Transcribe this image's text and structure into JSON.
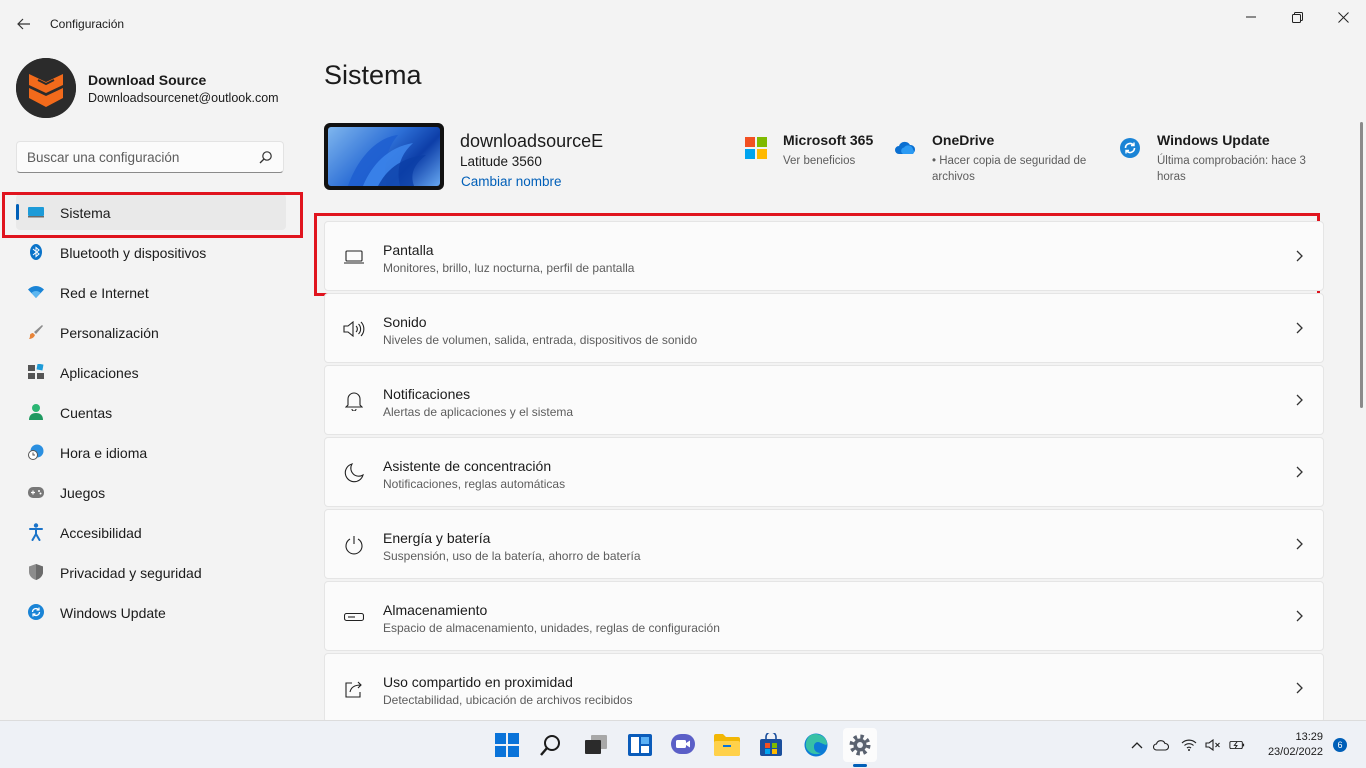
{
  "window": {
    "title": "Configuración"
  },
  "profile": {
    "name": "Download Source",
    "email": "Downloadsourcenet@outlook.com"
  },
  "search": {
    "placeholder": "Buscar una configuración"
  },
  "sidebar": {
    "items": [
      {
        "label": "Sistema",
        "icon": "system-icon",
        "selected": true
      },
      {
        "label": "Bluetooth y dispositivos",
        "icon": "bluetooth-icon"
      },
      {
        "label": "Red e Internet",
        "icon": "wifi-icon"
      },
      {
        "label": "Personalización",
        "icon": "brush-icon"
      },
      {
        "label": "Aplicaciones",
        "icon": "apps-icon"
      },
      {
        "label": "Cuentas",
        "icon": "person-icon"
      },
      {
        "label": "Hora e idioma",
        "icon": "clock-globe-icon"
      },
      {
        "label": "Juegos",
        "icon": "gamepad-icon"
      },
      {
        "label": "Accesibilidad",
        "icon": "accessibility-icon"
      },
      {
        "label": "Privacidad y seguridad",
        "icon": "shield-icon"
      },
      {
        "label": "Windows Update",
        "icon": "update-icon"
      }
    ]
  },
  "main": {
    "title": "Sistema",
    "device": {
      "name": "downloadsourceE",
      "model": "Latitude 3560",
      "rename_link": "Cambiar nombre"
    },
    "info": [
      {
        "title": "Microsoft 365",
        "sub": "Ver beneficios",
        "icon": "microsoft-logo-icon"
      },
      {
        "title": "OneDrive",
        "sub": "• Hacer copia de seguridad de archivos",
        "icon": "onedrive-cloud-icon"
      },
      {
        "title": "Windows Update",
        "sub": "Última comprobación: hace 3 horas",
        "icon": "windows-update-icon"
      }
    ],
    "cards": [
      {
        "title": "Pantalla",
        "sub": "Monitores, brillo, luz nocturna, perfil de pantalla",
        "icon": "display-icon"
      },
      {
        "title": "Sonido",
        "sub": "Niveles de volumen, salida, entrada, dispositivos de sonido",
        "icon": "speaker-icon"
      },
      {
        "title": "Notificaciones",
        "sub": "Alertas de aplicaciones y el sistema",
        "icon": "bell-icon"
      },
      {
        "title": "Asistente de concentración",
        "sub": "Notificaciones, reglas automáticas",
        "icon": "moon-icon"
      },
      {
        "title": "Energía y batería",
        "sub": "Suspensión, uso de la batería, ahorro de batería",
        "icon": "power-icon"
      },
      {
        "title": "Almacenamiento",
        "sub": "Espacio de almacenamiento, unidades, reglas de configuración",
        "icon": "storage-drive-icon"
      },
      {
        "title": "Uso compartido en proximidad",
        "sub": "Detectabilidad, ubicación de archivos recibidos",
        "icon": "share-icon"
      }
    ]
  },
  "taskbar": {
    "apps": [
      "windows-start-icon",
      "search-icon",
      "task-view-icon",
      "widgets-icon",
      "teams-chat-icon",
      "file-explorer-icon",
      "store-icon",
      "edge-icon",
      "settings-gear-icon"
    ],
    "time": "13:29",
    "date": "23/02/2022",
    "notifications": "6"
  },
  "colors": {
    "accent": "#005fb8",
    "highlight_box": "#e0141e",
    "background": "#f3f3f3"
  }
}
